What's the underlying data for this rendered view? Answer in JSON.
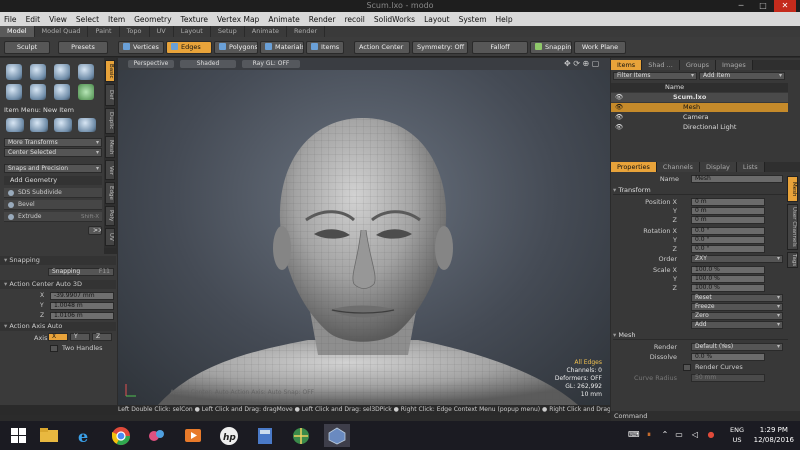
{
  "window": {
    "title": "Scum.lxo - modo"
  },
  "menubar": [
    "File",
    "Edit",
    "View",
    "Select",
    "Item",
    "Geometry",
    "Texture",
    "Vertex Map",
    "Animate",
    "Render",
    "recoil",
    "SolidWorks",
    "Layout",
    "System",
    "Help"
  ],
  "layout_tabs": [
    "Model",
    "Model Quad",
    "Paint",
    "Topo",
    "UV",
    "Layout",
    "Setup",
    "Animate",
    "Render"
  ],
  "toolbar": {
    "sculpt": "Sculpt",
    "presets": "Presets",
    "modes": [
      "Vertices",
      "Edges",
      "Polygons",
      "Materials",
      "Items"
    ],
    "action_center": "Action Center",
    "symmetry": "Symmetry: Off",
    "falloff": "Falloff",
    "snapping": "Snapping",
    "work_plane": "Work Plane"
  },
  "left_vtabs": [
    "Basic",
    "Def",
    "Duplic",
    "Mesh",
    "Ver",
    "Edge",
    "Poly",
    "UV"
  ],
  "left_panel": {
    "item_menu": "Item Menu: New Item",
    "more_transforms": "More Transforms",
    "center_selected": "Center Selected",
    "snaps": "Snaps and Precision",
    "add_geometry": "Add Geometry",
    "tools": [
      {
        "label": "SDS Subdivide",
        "shortcut": ""
      },
      {
        "label": "Bevel",
        "shortcut": ""
      },
      {
        "label": "Extrude",
        "shortcut": "Shift-X"
      }
    ],
    "more": ">>",
    "snapping_section": "Snapping",
    "snapping_btn": "Snapping",
    "snapping_key": "F11",
    "ac_section": "Action Center Auto 3D",
    "x_val": "-39.9907 mm",
    "y_val": "1.0048 m",
    "z_val": "1.0106 m",
    "axis_section": "Action Axis Auto",
    "axis_label": "Axis",
    "axis_opts": [
      "X",
      "Y",
      "Z"
    ],
    "two_handles": "Two Handles"
  },
  "viewport": {
    "view": "Perspective",
    "shading": "Shaded",
    "raygl": "Ray GL: OFF",
    "bottom_text": "Action Center: Auto  Action Axis: Auto  Snap: OFF",
    "info": {
      "mode": "All Edges",
      "channels": "Channels: 0",
      "deformers": "Deformers: OFF",
      "gl": "GL: 262,992",
      "size": "10 mm"
    }
  },
  "status_bar": "Left Double Click: selCon ● Left Click and Drag: dragMove ● Left Click and Drag: sel3DPick ● Right Click: Edge Context Menu (popup menu) ● Right Click and Drag: sel3",
  "right_panel": {
    "top_tabs": [
      "Items",
      "Shad ...",
      "Groups",
      "Images"
    ],
    "filter": "Filter Items",
    "add_item": "Add Item",
    "name_col": "Name",
    "tree": [
      "Scum.lxo",
      "Mesh",
      "Camera",
      "Directional Light"
    ],
    "prop_tabs": [
      "Properties",
      "Channels",
      "Display",
      "Lists"
    ],
    "name_label": "Name",
    "name_value": "Mesh",
    "transform_section": "Transform",
    "position_label": "Position X",
    "pos": [
      "0 m",
      "0 m",
      "0 m"
    ],
    "rotation_label": "Rotation X",
    "rot": [
      "0.0 °",
      "0.0 °",
      "0.0 °"
    ],
    "order_label": "Order",
    "order": "ZXY",
    "scale_label": "Scale X",
    "scale": [
      "100.0 %",
      "100.0 %",
      "100.0 %"
    ],
    "axis_y": "Y",
    "axis_z": "Z",
    "reset_items": [
      "Reset",
      "Freeze",
      "Zero",
      "Add"
    ],
    "mesh_section": "Mesh",
    "render_label": "Render",
    "render_value": "Default (Yes)",
    "dissolve_label": "Dissolve",
    "dissolve_value": "0.0 %",
    "render_curves": "Render Curves",
    "curve_radius_label": "Curve Radius",
    "curve_radius_value": "50 mm",
    "side_vtabs": [
      "Mesh",
      "User Channels",
      "Tags"
    ]
  },
  "command": "Command",
  "taskbar": {
    "lang": "ENG",
    "region": "US",
    "time": "1:29 PM",
    "date": "12/08/2016"
  }
}
